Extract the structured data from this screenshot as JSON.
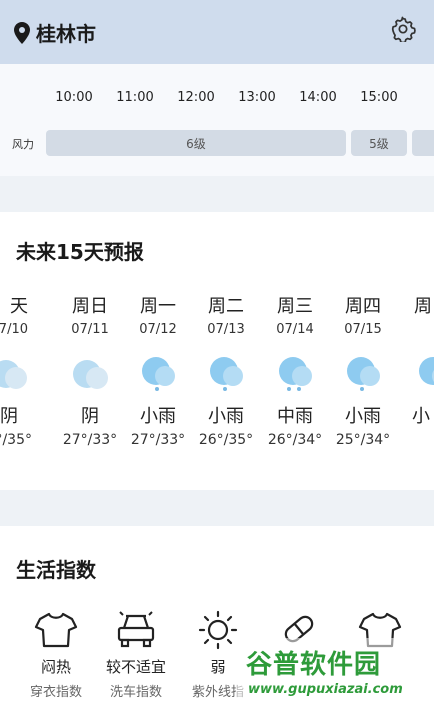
{
  "header": {
    "city": "桂林市"
  },
  "hourly": {
    "times": [
      "10:00",
      "11:00",
      "12:00",
      "13:00",
      "14:00",
      "15:00"
    ],
    "wind_label": "风力",
    "wind_segments": [
      {
        "label": "6级"
      },
      {
        "label": "5级"
      },
      {
        "label": ""
      }
    ]
  },
  "forecast": {
    "title": "未来15天预报",
    "days": [
      {
        "name": "天",
        "date": "7/10",
        "cond": "阴",
        "temp": "°/35°",
        "icon": "cloudy-icon"
      },
      {
        "name": "周日",
        "date": "07/11",
        "cond": "阴",
        "temp": "27°/33°",
        "icon": "cloudy-icon"
      },
      {
        "name": "周一",
        "date": "07/12",
        "cond": "小雨",
        "temp": "27°/33°",
        "icon": "light-rain-icon"
      },
      {
        "name": "周二",
        "date": "07/13",
        "cond": "小雨",
        "temp": "26°/35°",
        "icon": "light-rain-icon"
      },
      {
        "name": "周三",
        "date": "07/14",
        "cond": "中雨",
        "temp": "26°/34°",
        "icon": "moderate-rain-icon"
      },
      {
        "name": "周四",
        "date": "07/15",
        "cond": "小雨",
        "temp": "25°/34°",
        "icon": "light-rain-icon"
      },
      {
        "name": "周",
        "date": "",
        "cond": "小",
        "temp": "",
        "icon": "light-rain-icon"
      }
    ]
  },
  "life": {
    "title": "生活指数",
    "items": [
      {
        "value": "闷热",
        "name": "穿衣指数",
        "icon": "tshirt-icon"
      },
      {
        "value": "较不适宜",
        "name": "洗车指数",
        "icon": "car-icon"
      },
      {
        "value": "弱",
        "name": "紫外线指",
        "icon": "sun-icon"
      },
      {
        "value": "",
        "name": "",
        "icon": "pill-icon"
      },
      {
        "value": "",
        "name": "",
        "icon": "tshirt-icon"
      }
    ]
  },
  "watermark": {
    "title": "谷普软件园",
    "url": "www.gupuxiazai.com"
  },
  "colors": {
    "header_bg": "#cfdced",
    "bar_bg": "#d3dbe5",
    "weather_icon": "#8ecbf0",
    "watermark": "#2e9b3a"
  }
}
